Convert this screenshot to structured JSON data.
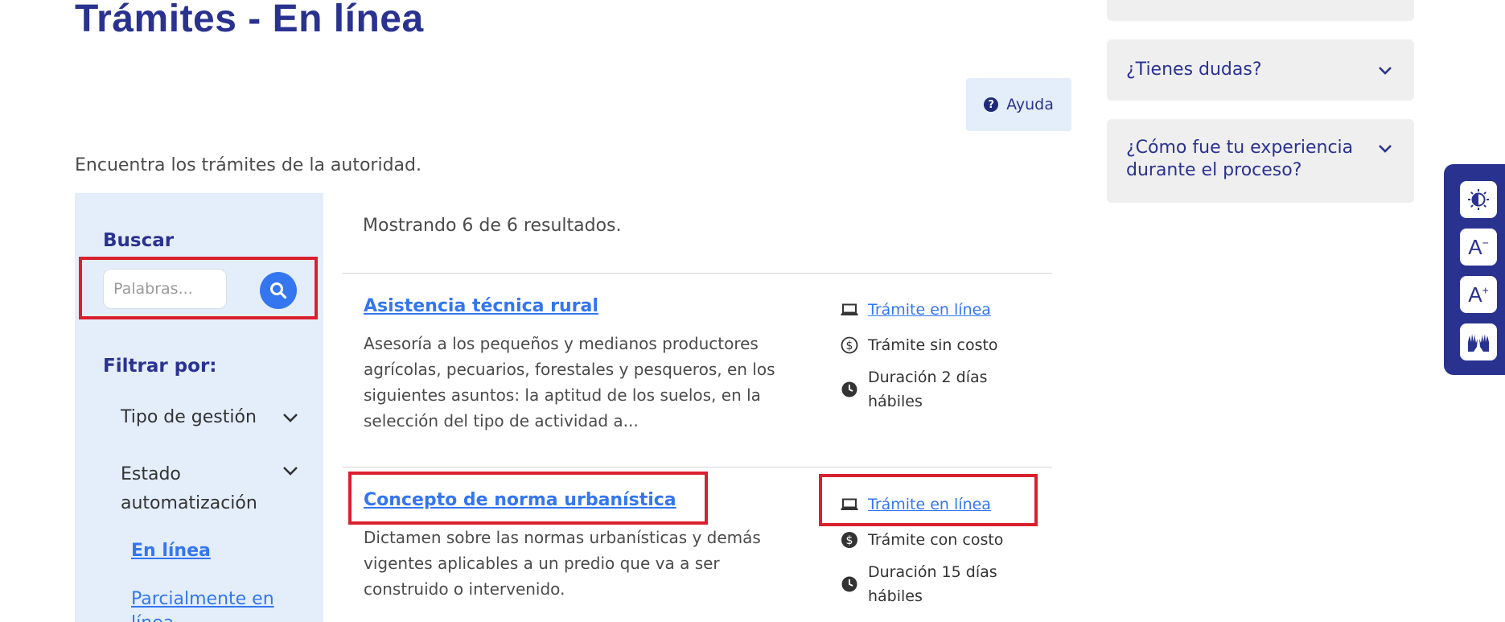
{
  "page": {
    "title": "Trámites - En línea",
    "help_label": "Ayuda",
    "intro": "Encuentra los trámites de la autoridad."
  },
  "sidebar": {
    "search_label": "Buscar",
    "search_placeholder": "Palabras...",
    "filter_label": "Filtrar por:",
    "filters": [
      {
        "label": "Tipo de gestión"
      },
      {
        "label": "Estado automatización"
      }
    ],
    "status_options": [
      {
        "label": "En línea"
      },
      {
        "label": "Parcialmente en línea"
      }
    ]
  },
  "results": {
    "count_text": "Mostrando 6 de 6 resultados.",
    "items": [
      {
        "title": "Asistencia técnica rural",
        "description": "Asesoría a los pequeños y medianos productores agrícolas, pecuarios, forestales y pesqueros, en los siguientes asuntos: la aptitud de los suelos, en la selección del tipo de actividad a...",
        "mode": "Trámite en línea",
        "cost": "Trámite sin costo",
        "duration": "Duración 2 días hábiles"
      },
      {
        "title": "Concepto de norma urbanística",
        "description": "Dictamen sobre las normas urbanísticas y demás vigentes aplicables a un predio que va a ser construido o intervenido.",
        "mode": "Trámite en línea",
        "cost": "Trámite con costo",
        "duration": "Duración 15 días hábiles"
      }
    ]
  },
  "aside": {
    "accordions": [
      {
        "label": "¿Tienes dudas?"
      },
      {
        "label": "¿Cómo fue tu experiencia durante el proceso?"
      }
    ]
  },
  "accessibility": {
    "buttons": [
      {
        "icon": "contrast-icon"
      },
      {
        "icon": "decrease-font-icon",
        "glyph": "A",
        "sup": "−"
      },
      {
        "icon": "increase-font-icon",
        "glyph": "A",
        "sup": "+"
      },
      {
        "icon": "sign-language-icon"
      }
    ]
  },
  "colors": {
    "title": "#2a3290",
    "link": "#3376f0",
    "sidebar_bg": "#e4eefb",
    "highlight": "#d9202e",
    "accessibility_bar": "#2a3290"
  }
}
